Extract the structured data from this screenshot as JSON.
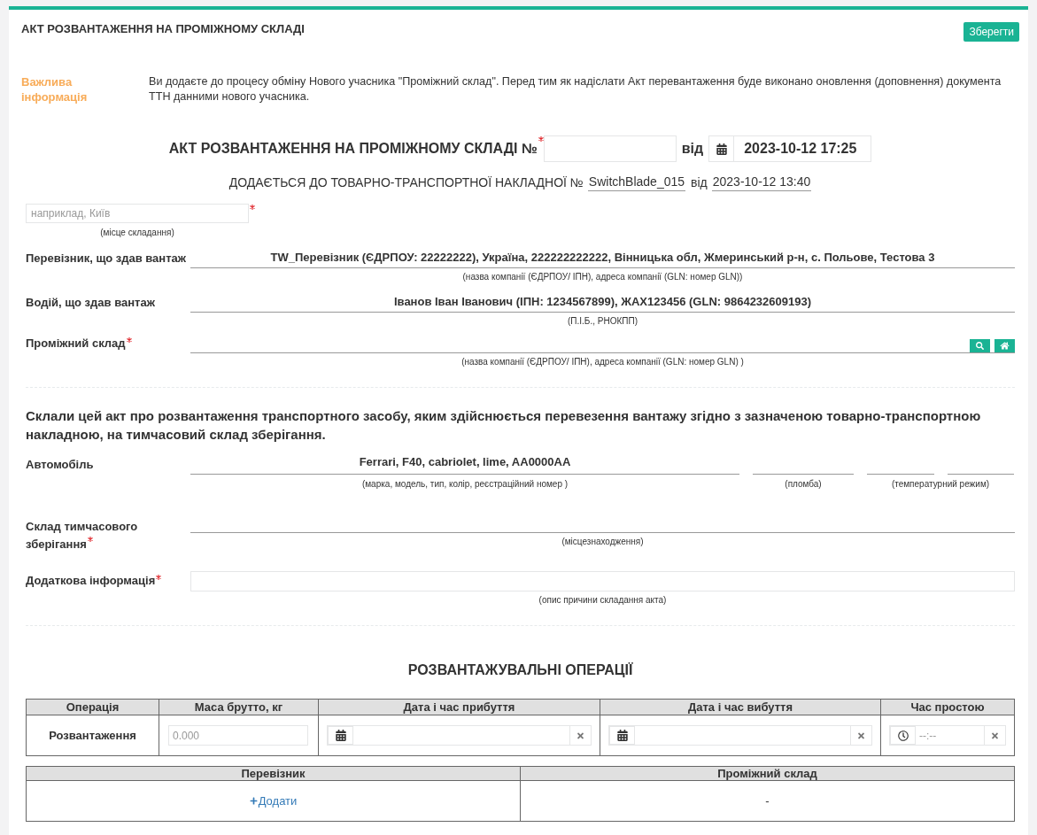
{
  "header": {
    "title": "АКТ РОЗВАНТАЖЕННЯ НА ПРОМІЖНОМУ СКЛАДІ",
    "save_button": "Зберегти"
  },
  "notice": {
    "label": "Важлива інформація",
    "text": "Ви додаєте до процесу обміну Нового учасника \"Проміжний склад\". Перед тим як надіслати Акт перевантаження буде виконано оновлення (доповнення) документа ТТН данними нового учасника."
  },
  "act": {
    "title": "АКТ РОЗВАНТАЖЕННЯ НА ПРОМІЖНОМУ СКЛАДІ №",
    "number": {
      "required": true
    },
    "date_label": "від",
    "date": "2023-10-12 17:25"
  },
  "waybill": {
    "label": "ДОДАЄТЬСЯ ДО ТОВАРНО-ТРАНСПОРТНОЇ НАКЛАДНОЇ №",
    "number": "SwitchBlade_015",
    "date_label": "від",
    "date": "2023-10-12 13:40"
  },
  "place": {
    "placeholder": "наприклад, Київ",
    "required": true,
    "caption": "(місце складання)"
  },
  "parties": [
    {
      "kind": "text",
      "label": "Перевізник, що здав вантаж",
      "required": false,
      "value": "TW_Перевізник (ЄДРПОУ: 22222222), Україна, 222222222222, Вінницька обл, Жмеринський р-н, с. Польове, Тестова 3",
      "caption": "(назва компанії (ЄДРПОУ/ ІПН), адреса компанії (GLN: номер GLN))"
    },
    {
      "kind": "text",
      "label": "Водій, що здав вантаж",
      "required": false,
      "value": "Іванов Іван Іванович (ІПН: 1234567899), ЖАХ123456 (GLN: 9864232609193)",
      "caption": "(П.І.Б., РНОКПП)"
    },
    {
      "kind": "lookup",
      "label": "Проміжний склад",
      "required": true,
      "caption": "(назва компанії (ЄДРПОУ/ ІПН), адреса компанії (GLN: номер GLN) )"
    }
  ],
  "statement": "Склали цей акт про розвантаження транспортного засобу, яким здійснюється перевезення вантажу згідно з зазначеною товарно-транспортною накладною, на тимчасовий склад зберігання.",
  "vehicle": {
    "label": "Автомобіль",
    "value": "Ferrari, F40, cabriolet, lime, AA0000AA",
    "caption": "(марка, модель, тип, колір, реєстраційний номер )",
    "seal_caption": "(пломба)",
    "temperature_caption": "(температурний режим)"
  },
  "storage": {
    "label": "Склад тимчасового зберігання",
    "required": true,
    "caption": "(місцезнаходження)"
  },
  "additional_info": {
    "label": "Додаткова інформація",
    "required": true,
    "caption": "(опис причини складання акта)"
  },
  "operations": {
    "title": "РОЗВАНТАЖУВАЛЬНІ ОПЕРАЦІЇ",
    "columns": [
      "Операція",
      "Маса брутто, кг",
      "Дата і час прибуття",
      "Дата і час вибуття",
      "Час простою"
    ],
    "rows": [
      {
        "operation": "Розвантаження",
        "mass_placeholder": "0.000",
        "idle_time_placeholder": "--:--"
      }
    ]
  },
  "responsibility": {
    "columns": [
      "Перевізник",
      "Проміжний склад"
    ],
    "rows": [
      {
        "carrier_action": "Додати",
        "warehouse": "-"
      }
    ]
  }
}
